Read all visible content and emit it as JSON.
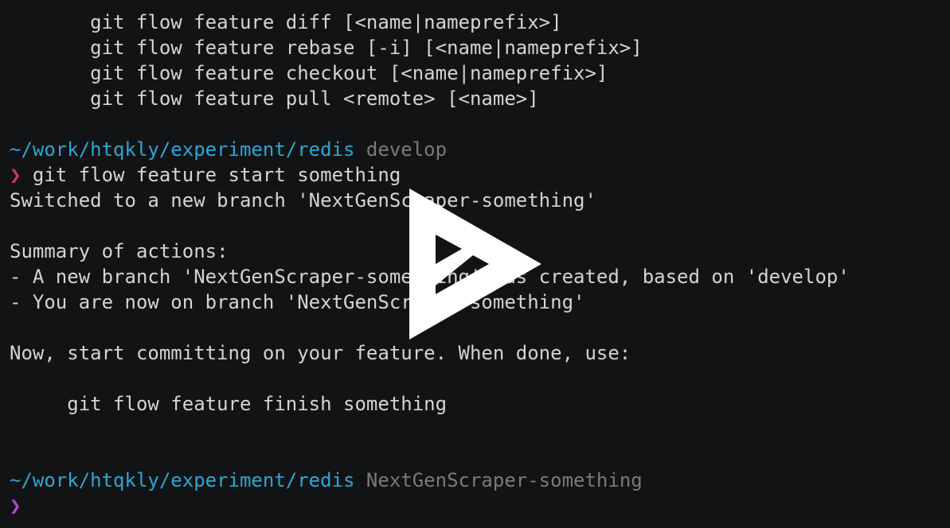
{
  "terminal": {
    "usage_lines": [
      "       git flow feature diff [<name|nameprefix>]",
      "       git flow feature rebase [-i] [<name|nameprefix>]",
      "       git flow feature checkout [<name|nameprefix>]",
      "       git flow feature pull <remote> [<name>]"
    ],
    "prompt1": {
      "path": "~/work/htqkly/experiment/redis",
      "branch": " develop",
      "symbol": "❯",
      "command": " git flow feature start something"
    },
    "output": {
      "switched": "Switched to a new branch 'NextGenScraper-something'",
      "summary_title": "Summary of actions:",
      "summary_1": "- A new branch 'NextGenScraper-something' was created, based on 'develop'",
      "summary_2": "- You are now on branch 'NextGenScraper-something'",
      "now_start": "Now, start committing on your feature. When done, use:",
      "finish_cmd": "     git flow feature finish something"
    },
    "prompt2": {
      "path": "~/work/htqkly/experiment/redis",
      "branch": " NextGenScraper-something",
      "symbol": "❯"
    }
  },
  "overlay": {
    "icon": "play-icon",
    "color": "#ffffff"
  },
  "colors": {
    "background": "#121314",
    "text": "#d4d4d4",
    "path": "#2aa7d6",
    "branch": "#7a7a7a",
    "prompt_active": "#d6336c",
    "prompt_idle": "#b24ad6"
  }
}
